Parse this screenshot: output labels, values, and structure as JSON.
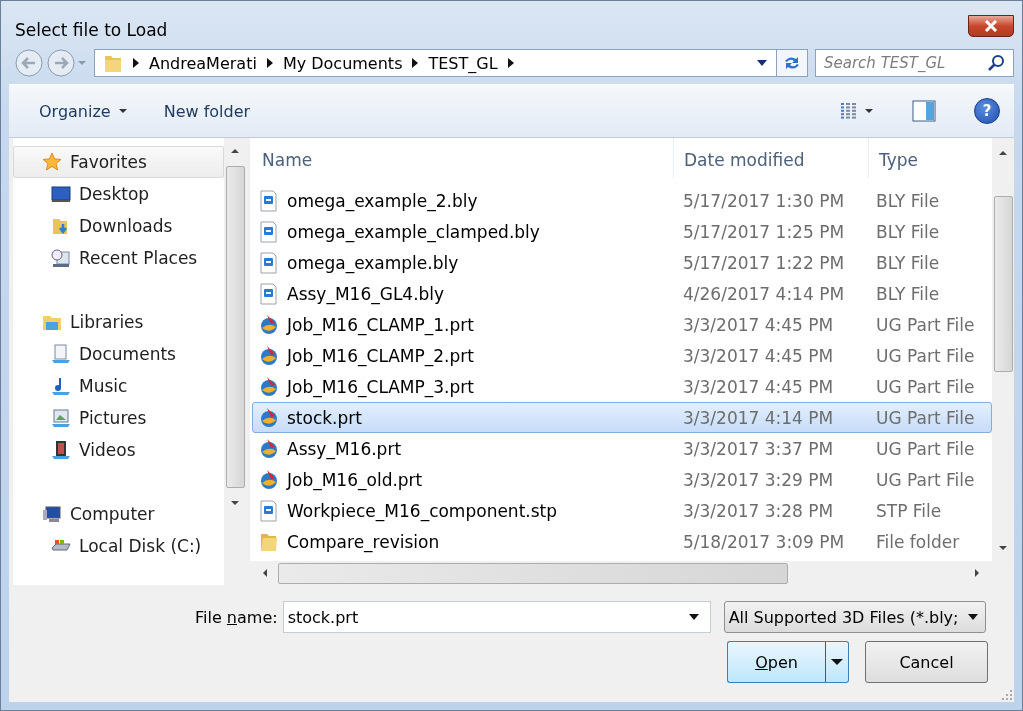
{
  "window": {
    "title": "Select file to Load"
  },
  "address_bar": {
    "segments": [
      "AndreaMerati",
      "My Documents",
      "TEST_GL"
    ]
  },
  "search": {
    "placeholder": "Search TEST_GL"
  },
  "toolbar": {
    "organize": "Organize",
    "new_folder": "New folder",
    "help": "?"
  },
  "sidebar": {
    "groups": [
      {
        "label": "Favorites",
        "kind": "star",
        "selected": true,
        "children": [
          {
            "label": "Desktop",
            "kind": "desktop",
            "selected": false
          },
          {
            "label": "Downloads",
            "kind": "downloads",
            "selected": false
          },
          {
            "label": "Recent Places",
            "kind": "recent",
            "selected": false
          }
        ]
      },
      {
        "label": "Libraries",
        "kind": "libraries",
        "selected": false,
        "children": [
          {
            "label": "Documents",
            "kind": "documents",
            "selected": false
          },
          {
            "label": "Music",
            "kind": "music",
            "selected": false
          },
          {
            "label": "Pictures",
            "kind": "pictures",
            "selected": false
          },
          {
            "label": "Videos",
            "kind": "videos",
            "selected": false
          }
        ]
      },
      {
        "label": "Computer",
        "kind": "computer",
        "selected": false,
        "children": [
          {
            "label": "Local Disk (C:)",
            "kind": "disk",
            "selected": false
          }
        ]
      }
    ]
  },
  "file_list": {
    "columns": [
      "Name",
      "Date modified",
      "Type"
    ],
    "rows": [
      {
        "name": "omega_example_2.bly",
        "date": "5/17/2017 1:30 PM",
        "type": "BLY File",
        "kind": "doc",
        "selected": false
      },
      {
        "name": "omega_example_clamped.bly",
        "date": "5/17/2017 1:25 PM",
        "type": "BLY File",
        "kind": "doc",
        "selected": false
      },
      {
        "name": "omega_example.bly",
        "date": "5/17/2017 1:22 PM",
        "type": "BLY File",
        "kind": "doc",
        "selected": false
      },
      {
        "name": "Assy_M16_GL4.bly",
        "date": "4/26/2017 4:14 PM",
        "type": "BLY File",
        "kind": "doc",
        "selected": false
      },
      {
        "name": "Job_M16_CLAMP_1.prt",
        "date": "3/3/2017 4:45 PM",
        "type": "UG Part File",
        "kind": "part",
        "selected": false
      },
      {
        "name": "Job_M16_CLAMP_2.prt",
        "date": "3/3/2017 4:45 PM",
        "type": "UG Part File",
        "kind": "part",
        "selected": false
      },
      {
        "name": "Job_M16_CLAMP_3.prt",
        "date": "3/3/2017 4:45 PM",
        "type": "UG Part File",
        "kind": "part",
        "selected": false
      },
      {
        "name": "stock.prt",
        "date": "3/3/2017 4:14 PM",
        "type": "UG Part File",
        "kind": "part",
        "selected": true
      },
      {
        "name": "Assy_M16.prt",
        "date": "3/3/2017 3:37 PM",
        "type": "UG Part File",
        "kind": "part",
        "selected": false
      },
      {
        "name": "Job_M16_old.prt",
        "date": "3/3/2017 3:29 PM",
        "type": "UG Part File",
        "kind": "part",
        "selected": false
      },
      {
        "name": "Workpiece_M16_component.stp",
        "date": "3/3/2017 3:28 PM",
        "type": "STP File",
        "kind": "doc",
        "selected": false
      },
      {
        "name": "Compare_revision",
        "date": "5/18/2017 3:09 PM",
        "type": "File folder",
        "kind": "folder",
        "selected": false
      }
    ]
  },
  "file_name": {
    "label_before": "File ",
    "access_key": "n",
    "label_after": "ame:",
    "value": "stock.prt"
  },
  "file_type": {
    "value": "All Supported 3D Files (*.bly;"
  },
  "buttons": [
    {
      "kind": "split",
      "access_key": "O",
      "after": "pen"
    },
    {
      "kind": "plain",
      "before": "Cancel"
    }
  ]
}
